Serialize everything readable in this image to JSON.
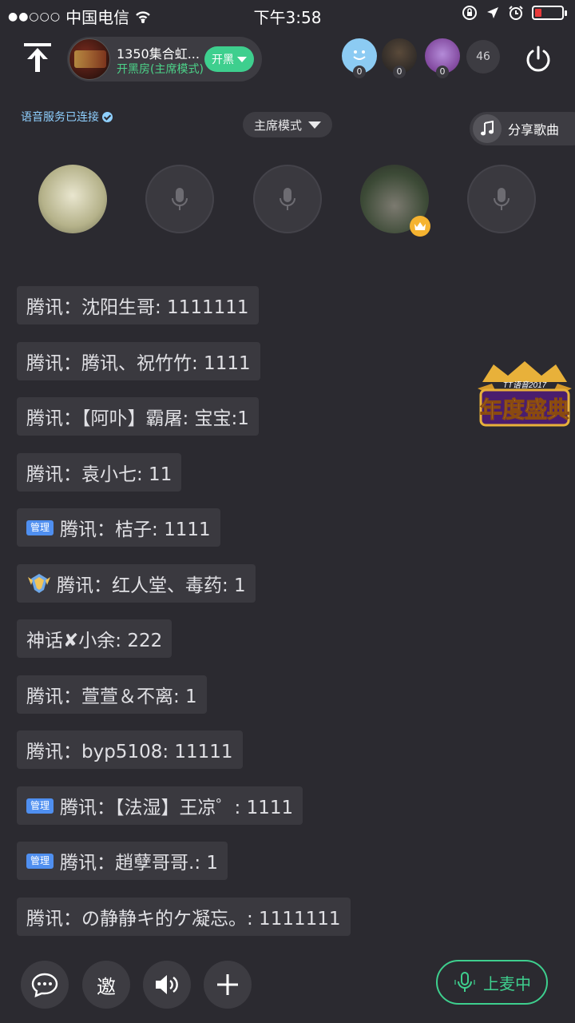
{
  "status_bar": {
    "signal_dots": "●●○○○",
    "carrier": "中国电信",
    "time": "下午3:58"
  },
  "header": {
    "room_title": "1350集合虹...",
    "room_subtitle": "开黑房(主席模式)",
    "kaihei_label": "开黑",
    "member_counts": [
      "0",
      "0",
      "0"
    ],
    "online_count": "46"
  },
  "voice_status": "语音服务已连接",
  "mode_select": "主席模式",
  "share_song_label": "分享歌曲",
  "event_badge": {
    "top_text": "TT语音2017",
    "main_text": "年度盛典"
  },
  "chat": [
    {
      "badge": "",
      "text": "腾讯：沈阳生哥: 1111111"
    },
    {
      "badge": "",
      "text": "腾讯：腾讯、祝竹竹: 1111"
    },
    {
      "badge": "",
      "text": "腾讯：【阿卟】霸屠: 宝宝:1"
    },
    {
      "badge": "",
      "text": "腾讯：袁小七: 11"
    },
    {
      "badge": "管理",
      "text": "腾讯：桔子: 1111"
    },
    {
      "badge": "",
      "text": "腾讯：红人堂、毒药: 1"
    },
    {
      "badge": "",
      "text": "神话✘小余: 222"
    },
    {
      "badge": "",
      "text": "腾讯：萱萱＆不离: 1"
    },
    {
      "badge": "",
      "text": "腾讯：byp5108: 11111"
    },
    {
      "badge": "管理",
      "text": "腾讯：【法湿】王凉゜: 1111"
    },
    {
      "badge": "管理",
      "text": "腾讯：趙孽哥哥.: 1"
    },
    {
      "badge": "",
      "text": "腾讯：の静静キ的ケ凝忘。: 1111111"
    }
  ],
  "bottom_bar": {
    "invite_label": "邀",
    "mic_up_label": "上麦中"
  },
  "colors": {
    "background": "#2b2a30",
    "accent_green": "#3ecf8e",
    "admin_badge": "#4f8ff0",
    "voice_status": "#8fd0ff"
  }
}
